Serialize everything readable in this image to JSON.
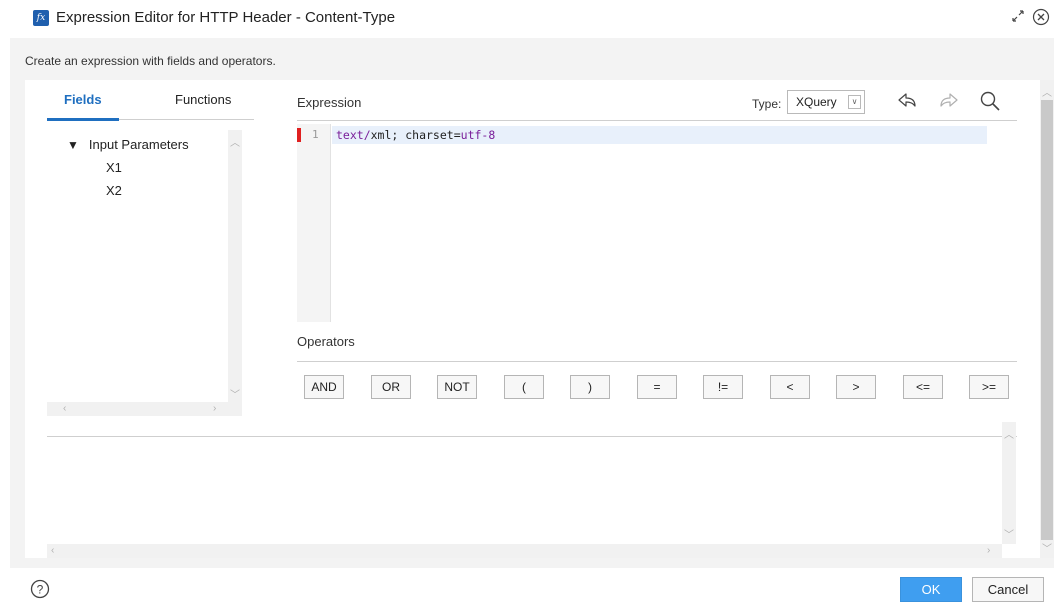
{
  "dialog": {
    "title": "Expression Editor for HTTP Header - Content-Type",
    "icon_text": "fx",
    "hint": "Create an expression with fields and operators."
  },
  "tabs": {
    "fields": "Fields",
    "functions": "Functions"
  },
  "tree": {
    "root": "Input Parameters",
    "children": [
      "X1",
      "X2"
    ]
  },
  "expression": {
    "label": "Expression",
    "type_label": "Type:",
    "type_value": "XQuery",
    "line_number": "1",
    "code": {
      "part1": "text/",
      "part2": "xml; charset=",
      "part3": "utf-8"
    }
  },
  "operators": {
    "label": "Operators",
    "items": [
      "AND",
      "OR",
      "NOT",
      "(",
      ")",
      "=",
      "!=",
      "<",
      ">",
      "<=",
      ">="
    ]
  },
  "footer": {
    "ok": "OK",
    "cancel": "Cancel",
    "help": "?"
  },
  "colors": {
    "accent": "#1f6fc0",
    "ok_button": "#3f9ef0",
    "error_marker": "#e02020",
    "keyword": "#7a1f9a"
  }
}
